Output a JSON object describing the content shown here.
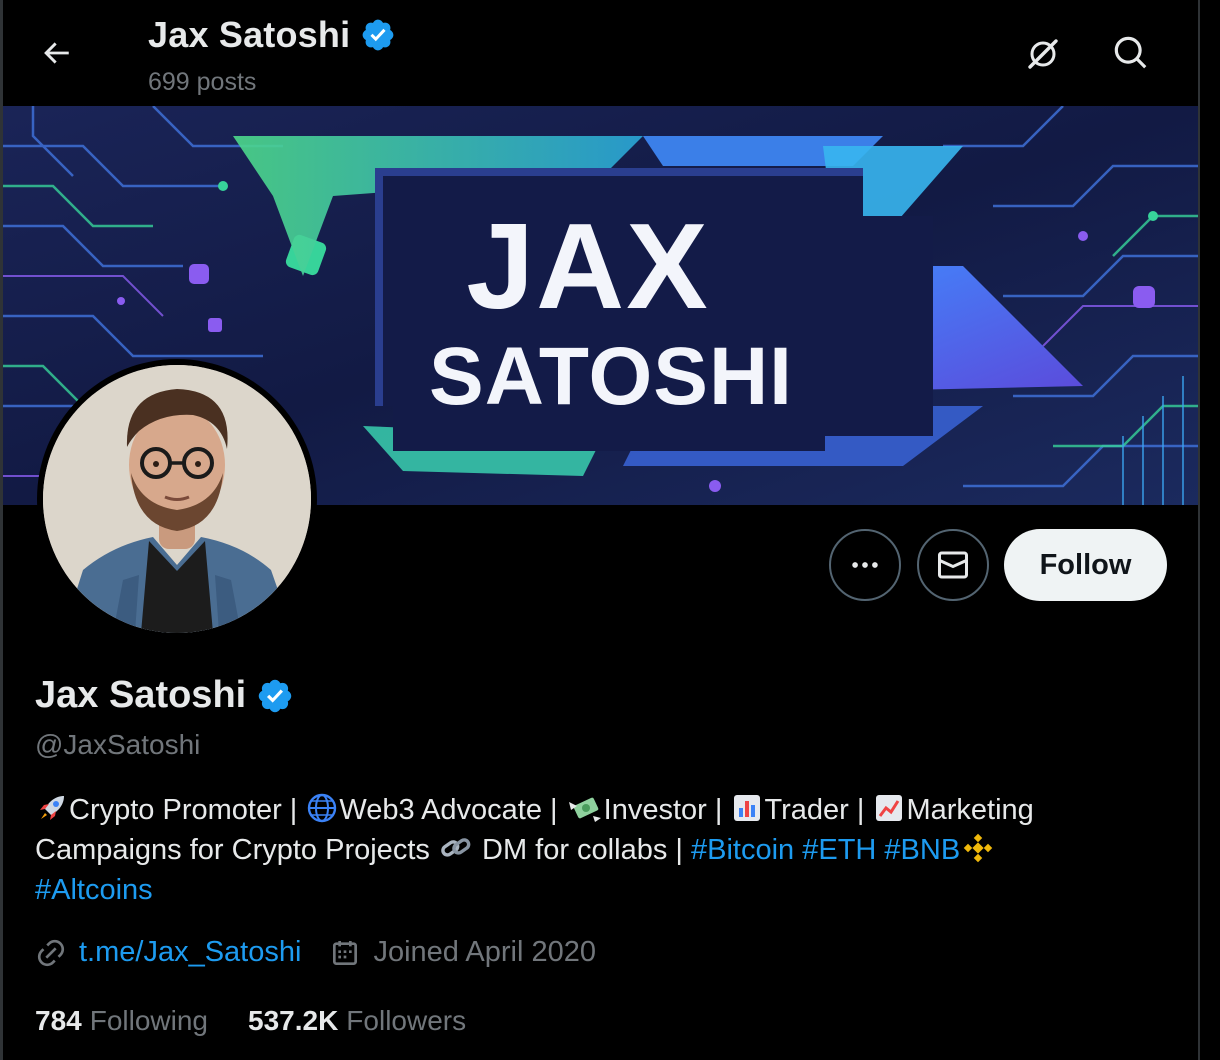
{
  "header": {
    "title": "Jax Satoshi",
    "posts": "699 posts"
  },
  "banner": {
    "line1": "JAX",
    "line2": "SATOSHI"
  },
  "profile": {
    "name": "Jax Satoshi",
    "handle": "@JaxSatoshi",
    "verified": true,
    "follow_label": "Follow"
  },
  "bio": {
    "p1": "Crypto Promoter | ",
    "p2": "Web3 Advocate | ",
    "p3": "Investor | ",
    "p4": "Trader | ",
    "p5": "Marketing Campaigns for Crypto Projects ",
    "p6": "DM for collabs | ",
    "tag1": "#Bitcoin",
    "tag2": "#ETH",
    "tag3": "#BNB",
    "tag4": "#Altcoins"
  },
  "meta": {
    "link": "t.me/Jax_Satoshi",
    "joined": "Joined April 2020"
  },
  "stats": {
    "following_count": "784",
    "following_label": "Following",
    "followers_count": "537.2K",
    "followers_label": "Followers"
  },
  "colors": {
    "accent": "#1d9bf0",
    "muted": "#71767b",
    "background": "#000000",
    "verified": "#1d9bf0"
  },
  "icons": {
    "back": "arrow-left-icon",
    "translate": "grok-icon",
    "search": "search-icon",
    "more": "more-icon",
    "message": "mail-icon",
    "link": "link-icon",
    "calendar": "calendar-icon"
  }
}
